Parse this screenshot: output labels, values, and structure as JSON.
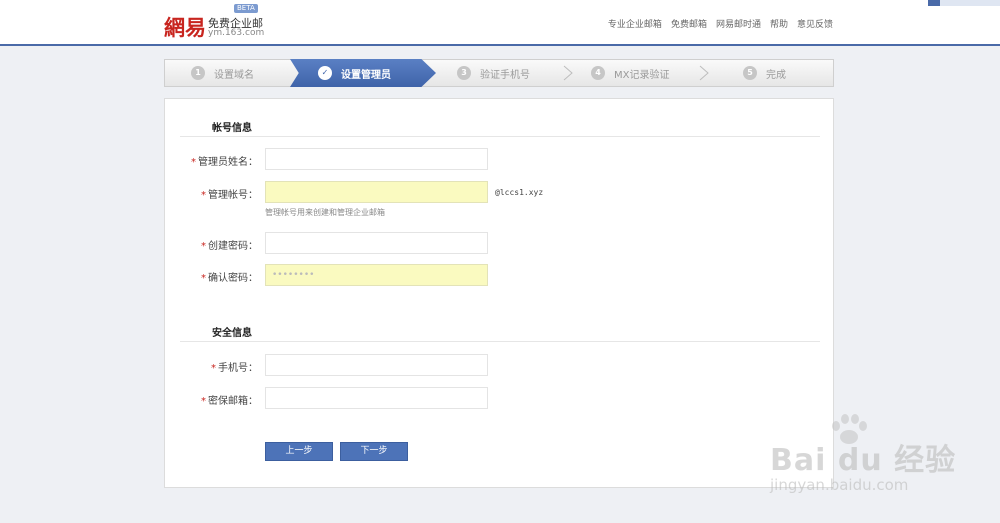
{
  "header": {
    "logo_text": "網易",
    "logo_product": "免费企业邮",
    "logo_domain": "ym.163.com",
    "logo_badge": "BETA",
    "nav": [
      "专业企业邮箱",
      "免费邮箱",
      "网易邮时通",
      "帮助",
      "意见反馈"
    ]
  },
  "steps": [
    {
      "num": "1",
      "label": "设置域名",
      "state": "done"
    },
    {
      "num": "✓",
      "label": "设置管理员",
      "state": "active"
    },
    {
      "num": "3",
      "label": "验证手机号",
      "state": "pending"
    },
    {
      "num": "4",
      "label": "MX记录验证",
      "state": "pending"
    },
    {
      "num": "5",
      "label": "完成",
      "state": "pending"
    }
  ],
  "account": {
    "title": "帐号信息",
    "admin_name_label": "管理员姓名：",
    "admin_account_label": "管理帐号：",
    "admin_account_suffix": "@lccs1.xyz",
    "admin_account_hint": "管理帐号用来创建和管理企业邮箱",
    "password_label": "创建密码：",
    "confirm_label": "确认密码：",
    "confirm_value": "••••••••"
  },
  "security": {
    "title": "安全信息",
    "phone_label": "手机号：",
    "email_label": "密保邮箱："
  },
  "buttons": {
    "prev": "上一步",
    "next": "下一步"
  },
  "watermark": {
    "brand": "Bai du 经验",
    "site": "jingyan.baidu.com"
  },
  "colors": {
    "accent": "#4a6aa8",
    "logo_red": "#c8251f",
    "autofill": "#fafac0"
  }
}
